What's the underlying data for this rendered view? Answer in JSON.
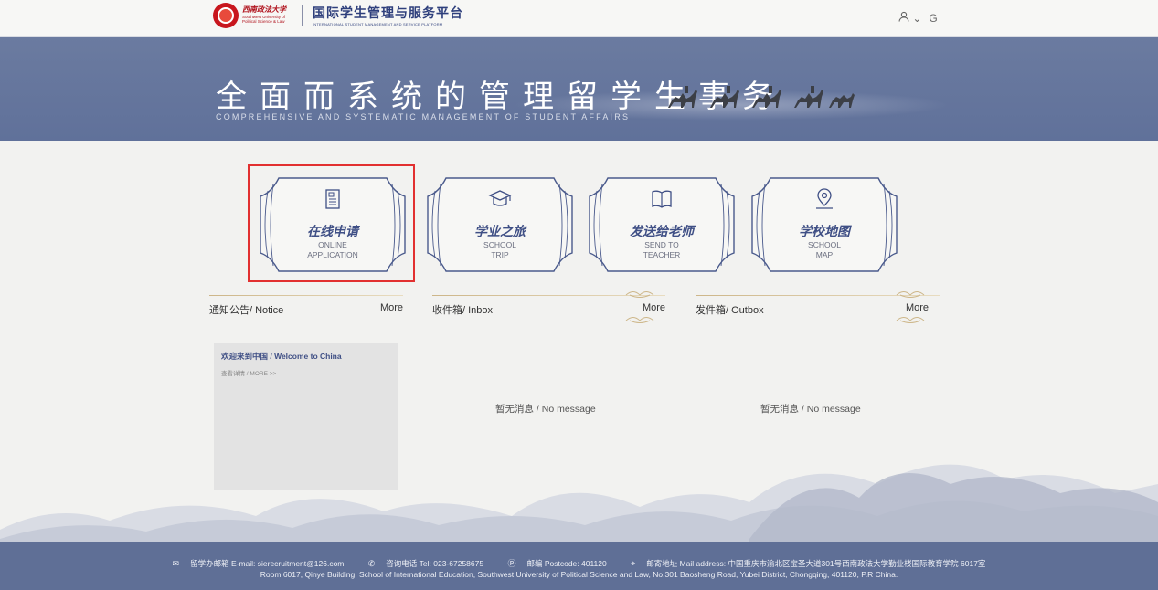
{
  "header": {
    "university_cn": "西南政法大学",
    "university_en_line1": "Southwest University of",
    "university_en_line2": "Political Science & Law",
    "platform_cn": "国际学生管理与服务平台",
    "platform_en": "INTERNATIONAL STUDENT MANAGEMENT AND SERVICE PLATFORM",
    "user_glyph": "ᴙ",
    "chevron_glyph": "⌄",
    "lang_glyph": "G"
  },
  "banner": {
    "title_cn": "全面而系统的管理留学生事务",
    "title_en": "COMPREHENSIVE AND SYSTEMATIC MANAGEMENT OF STUDENT AFFAIRS"
  },
  "cards": [
    {
      "cn": "在线申请",
      "en1": "ONLINE",
      "en2": "APPLICATION",
      "icon": "document-icon"
    },
    {
      "cn": "学业之旅",
      "en1": "SCHOOL",
      "en2": "TRIP",
      "icon": "graduation-cap-icon"
    },
    {
      "cn": "发送给老师",
      "en1": "SEND TO",
      "en2": "TEACHER",
      "icon": "book-icon"
    },
    {
      "cn": "学校地图",
      "en1": "SCHOOL",
      "en2": "MAP",
      "icon": "map-pin-icon"
    }
  ],
  "sections": {
    "notice": {
      "label": "通知公告/ Notice",
      "more": "More"
    },
    "inbox": {
      "label": "收件箱/ Inbox",
      "more": "More"
    },
    "outbox": {
      "label": "发件箱/ Outbox",
      "more": "More"
    }
  },
  "notice_item": {
    "title": "欢迎来到中国 / Welcome to China",
    "more": "查看详情 / MORE >>"
  },
  "inbox_empty": "暂无消息 / No message",
  "outbox_empty": "暂无消息 / No message",
  "footer": {
    "email": "留学办邮箱 E-mail: sierecruitment@126.com",
    "phone": "咨询电话 Tel: 023-67258675",
    "postcode": "邮编 Postcode: 401120",
    "address_cn": "邮寄地址 Mail address: 中国重庆市渝北区宝圣大道301号西南政法大学勤业楼国际教育学院 6017室",
    "address_en": "Room 6017, Qinye Building, School of International Education, Southwest University of Political Science and Law, No.301 Baosheng Road, Yubei District, Chongqing, 401120, P.R China."
  },
  "colors": {
    "brand_blue": "#3f4f85",
    "banner_bg": "#6b7ba0",
    "footer_bg": "#5f6f96",
    "logo_red": "#c8161d",
    "highlight_red": "#e23030"
  }
}
